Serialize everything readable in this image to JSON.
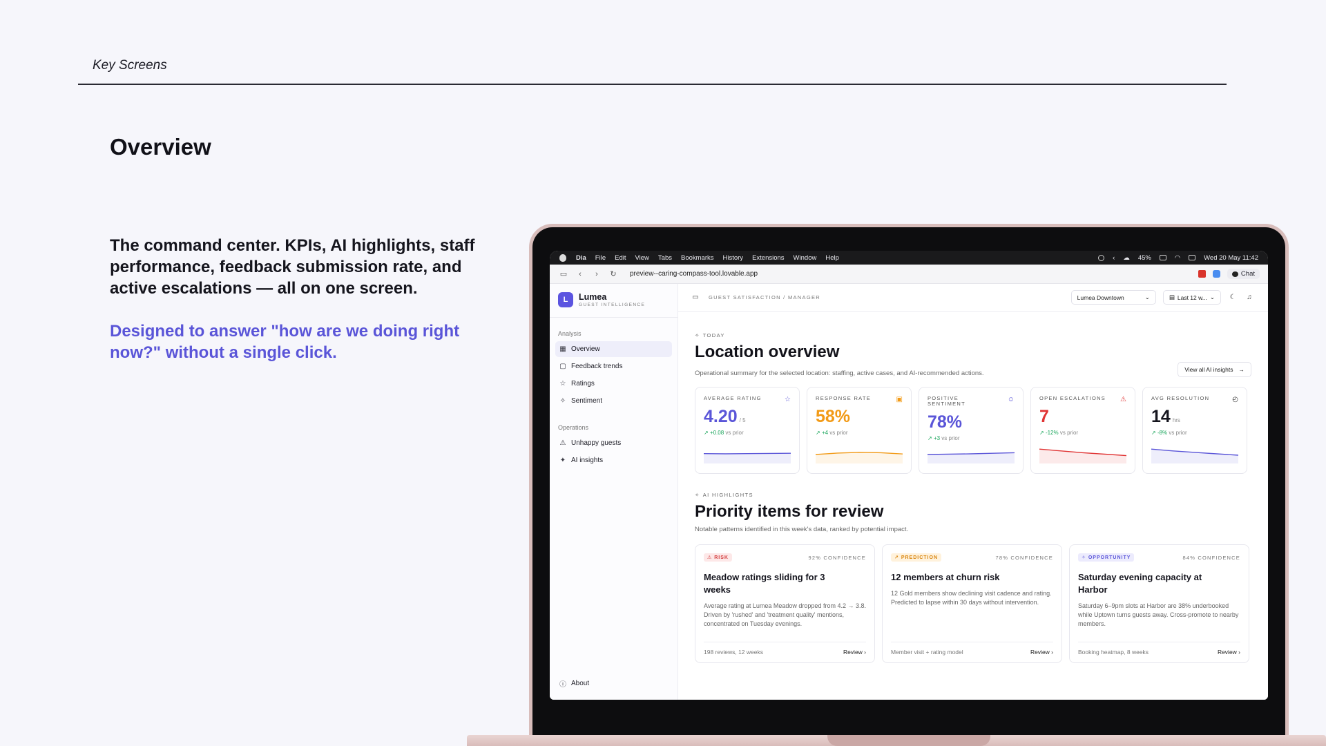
{
  "slide": {
    "section_label": "Key Screens",
    "title": "Overview",
    "description": "The command center. KPIs, AI highlights, staff performance, feedback submission rate, and active escalations — all on one screen.",
    "accent_text": "Designed to answer \"how are we doing right now?\" without a single click."
  },
  "menubar": {
    "items": [
      "Dia",
      "File",
      "Edit",
      "View",
      "Tabs",
      "Bookmarks",
      "History",
      "Extensions",
      "Window",
      "Help"
    ],
    "battery": "45%",
    "datetime": "Wed 20 May  11:42"
  },
  "browser": {
    "url": "preview--caring-compass-tool.lovable.app",
    "chat_label": "Chat"
  },
  "sidebar": {
    "brand_initial": "L",
    "brand_name": "Lumea",
    "brand_sub": "GUEST INTELLIGENCE",
    "group_analysis": "Analysis",
    "analysis_items": [
      {
        "label": "Overview",
        "icon": "grid-icon"
      },
      {
        "label": "Feedback trends",
        "icon": "chat-square-icon"
      },
      {
        "label": "Ratings",
        "icon": "star-icon"
      },
      {
        "label": "Sentiment",
        "icon": "sparkle-icon"
      }
    ],
    "group_operations": "Operations",
    "operations_items": [
      {
        "label": "Unhappy guests",
        "icon": "warning-icon"
      },
      {
        "label": "AI insights",
        "icon": "ai-icon"
      }
    ],
    "about_label": "About"
  },
  "topbar": {
    "breadcrumb": "GUEST SATISFACTION / MANAGER",
    "location": "Lumea Downtown",
    "period": "Last 12 w..."
  },
  "overview": {
    "eyebrow": "TODAY",
    "title": "Location overview",
    "subtitle": "Operational summary for the selected location: staffing, active cases, and AI-recommended actions.",
    "view_all": "View all AI insights"
  },
  "kpis": [
    {
      "label": "AVERAGE RATING",
      "value": "4.20",
      "unit": "/ 5",
      "delta": "+0.08",
      "delta_suffix": "vs prior",
      "color": "#5a55d8",
      "delta_color": "#19a55b",
      "icon": "star-icon",
      "trend": [
        0.45,
        0.46,
        0.45,
        0.44,
        0.43
      ]
    },
    {
      "label": "RESPONSE RATE",
      "value": "58%",
      "unit": "",
      "delta": "+4",
      "delta_suffix": "vs prior",
      "color": "#f29a16",
      "delta_color": "#19a55b",
      "icon": "message-icon",
      "trend": [
        0.5,
        0.42,
        0.38,
        0.4,
        0.47
      ]
    },
    {
      "label": "POSITIVE SENTIMENT",
      "value": "78%",
      "unit": "",
      "delta": "+3",
      "delta_suffix": "vs prior",
      "color": "#5a55d8",
      "delta_color": "#19a55b",
      "icon": "smile-icon",
      "trend": [
        0.5,
        0.48,
        0.46,
        0.43,
        0.4
      ]
    },
    {
      "label": "OPEN ESCALATIONS",
      "value": "7",
      "unit": "",
      "delta": "-12%",
      "delta_suffix": "vs prior",
      "color": "#e03434",
      "delta_color": "#19a55b",
      "icon": "alert-icon",
      "trend": [
        0.2,
        0.3,
        0.4,
        0.48,
        0.56
      ]
    },
    {
      "label": "AVG RESOLUTION",
      "value": "14",
      "unit": "hrs",
      "delta": "-8%",
      "delta_suffix": "vs prior",
      "color": "#15151e",
      "delta_color": "#19a55b",
      "icon": "clock-icon",
      "trend": [
        0.2,
        0.3,
        0.38,
        0.46,
        0.54
      ],
      "line_color": "#5a55d8"
    }
  ],
  "highlights": {
    "eyebrow": "AI HIGHLIGHTS",
    "title": "Priority items for review",
    "subtitle": "Notable patterns identified in this week's data, ranked by potential impact.",
    "cards": [
      {
        "badge": "RISK",
        "badge_kind": "risk",
        "confidence": "92% CONFIDENCE",
        "title": "Meadow ratings sliding for 3 weeks",
        "body": "Average rating at Lumea Meadow dropped from 4.2 → 3.8. Driven by 'rushed' and 'treatment quality' mentions, concentrated on Tuesday evenings.",
        "footer": "198 reviews, 12 weeks",
        "action": "Review ›"
      },
      {
        "badge": "PREDICTION",
        "badge_kind": "pred",
        "confidence": "78% CONFIDENCE",
        "title": "12 members at churn risk",
        "body": "12 Gold members show declining visit cadence and rating. Predicted to lapse within 30 days without intervention.",
        "footer": "Member visit + rating model",
        "action": "Review ›"
      },
      {
        "badge": "OPPORTUNITY",
        "badge_kind": "opp",
        "confidence": "84% CONFIDENCE",
        "title": "Saturday evening capacity at Harbor",
        "body": "Saturday 6–9pm slots at Harbor are 38% underbooked while Uptown turns guests away. Cross-promote to nearby members.",
        "footer": "Booking heatmap, 8 weeks",
        "action": "Review ›"
      }
    ]
  }
}
